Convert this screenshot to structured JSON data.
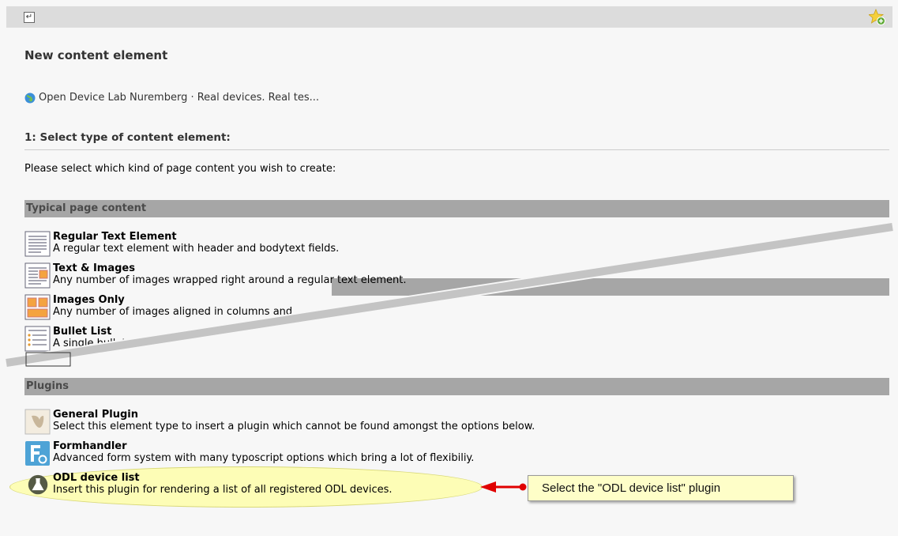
{
  "header": {
    "back_icon": "return-arrow-icon",
    "star_icon": "bookmark-star-add-icon"
  },
  "page_title": "New content element",
  "site": {
    "icon": "globe-icon",
    "title": "Open Device Lab Nuremberg · Real devices. Real tes..."
  },
  "step_heading": "1: Select type of content element:",
  "instructions": "Please select which kind of page content you wish to create:",
  "sections": {
    "typical": {
      "label": "Typical page content",
      "items": [
        {
          "title": "Regular Text Element",
          "desc": "A regular text element with header and bodytext fields.",
          "icon": "text-element-icon"
        },
        {
          "title": "Text & Images",
          "desc": "Any number of images wrapped right around a regular text element.",
          "icon": "text-images-icon"
        },
        {
          "title": "Images Only",
          "desc": "Any number of images aligned in columns and",
          "icon": "images-only-icon"
        },
        {
          "title": "Bullet List",
          "desc": "A single bullet list",
          "icon": "bullet-list-icon"
        }
      ]
    },
    "plugins": {
      "label": "Plugins",
      "items": [
        {
          "title": "General Plugin",
          "desc": "Select this element type to insert a plugin which cannot be found amongst the options below.",
          "icon": "general-plugin-icon"
        },
        {
          "title": "Formhandler",
          "desc": "Advanced form system with many typoscript options which bring a lot of flexibiliy.",
          "icon": "formhandler-icon"
        },
        {
          "title": "ODL device list",
          "desc": "Insert this plugin for rendering a list of all registered ODL devices.",
          "icon": "flask-icon"
        }
      ]
    }
  },
  "callout": {
    "text": "Select the \"ODL device list\" plugin",
    "color": "#fefec8",
    "arrow_color": "#e00000"
  },
  "colors": {
    "section_bar": "#a6a6a6",
    "top_bar": "#dcdcdc",
    "highlight": "#ffffa0"
  }
}
